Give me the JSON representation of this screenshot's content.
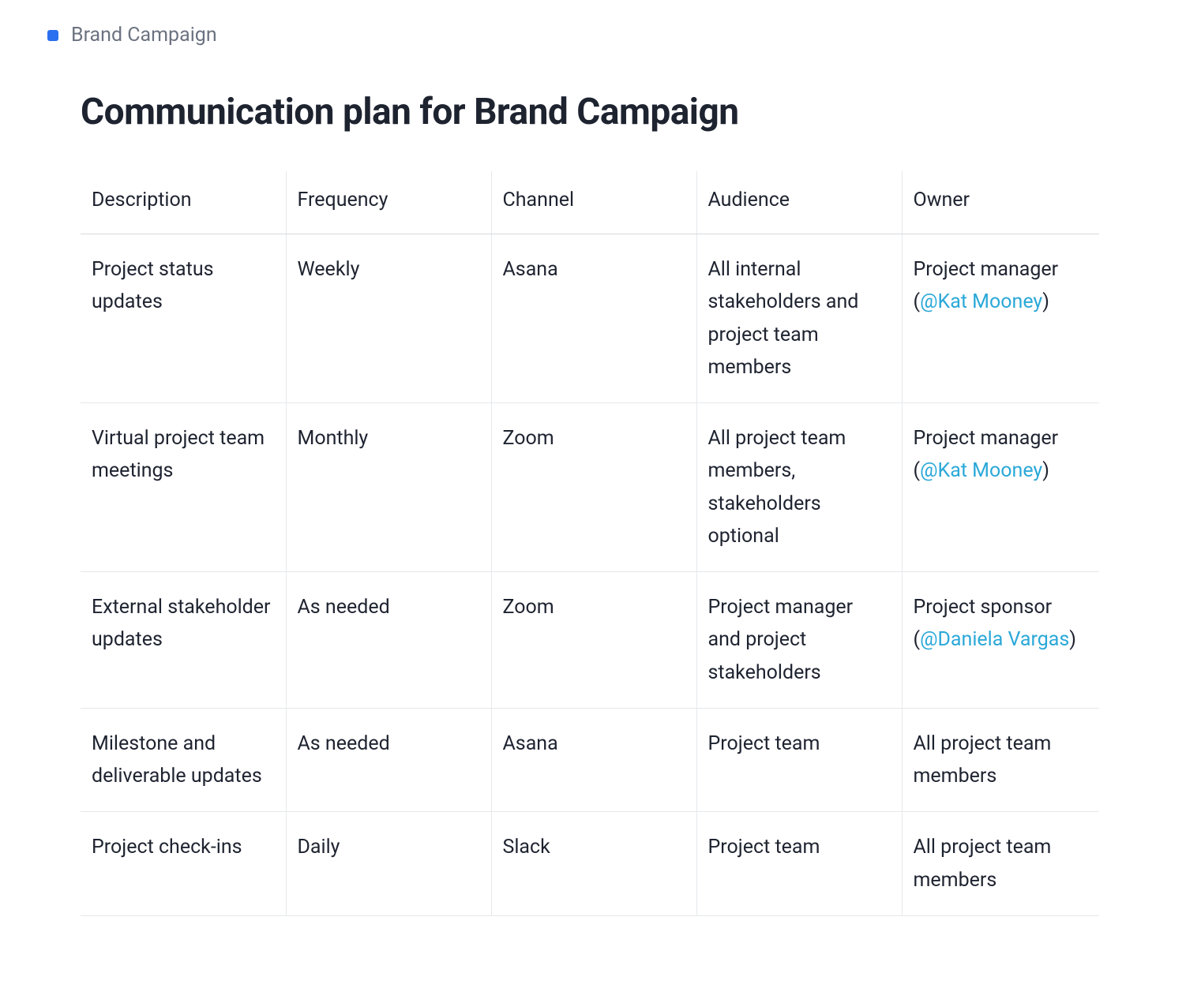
{
  "breadcrumb": {
    "label": "Brand Campaign"
  },
  "title": "Communication plan for Brand Campaign",
  "table": {
    "headers": {
      "description": "Description",
      "frequency": "Frequency",
      "channel": "Channel",
      "audience": "Audience",
      "owner": "Owner"
    },
    "rows": [
      {
        "description": "Project status updates",
        "frequency": "Weekly",
        "channel": "Asana",
        "audience": "All internal stakeholders and project team members",
        "owner_prefix": "Project manager (",
        "owner_mention": "@Kat Mooney",
        "owner_suffix": ")"
      },
      {
        "description": "Virtual project team meetings",
        "frequency": "Monthly",
        "channel": "Zoom",
        "audience": "All project team members, stakeholders optional",
        "owner_prefix": "Project manager (",
        "owner_mention": "@Kat Mooney",
        "owner_suffix": ")"
      },
      {
        "description": "External stakeholder updates",
        "frequency": "As needed",
        "channel": "Zoom",
        "audience": "Project manager and project stakeholders",
        "owner_prefix": "Project sponsor (",
        "owner_mention": "@Daniela Vargas",
        "owner_suffix": ")"
      },
      {
        "description": "Milestone and deliverable updates",
        "frequency": "As needed",
        "channel": "Asana",
        "audience": "Project team",
        "owner_prefix": "All project team members",
        "owner_mention": "",
        "owner_suffix": ""
      },
      {
        "description": "Project check-ins",
        "frequency": "Daily",
        "channel": "Slack",
        "audience": "Project team",
        "owner_prefix": "All project team members",
        "owner_mention": "",
        "owner_suffix": ""
      }
    ]
  }
}
